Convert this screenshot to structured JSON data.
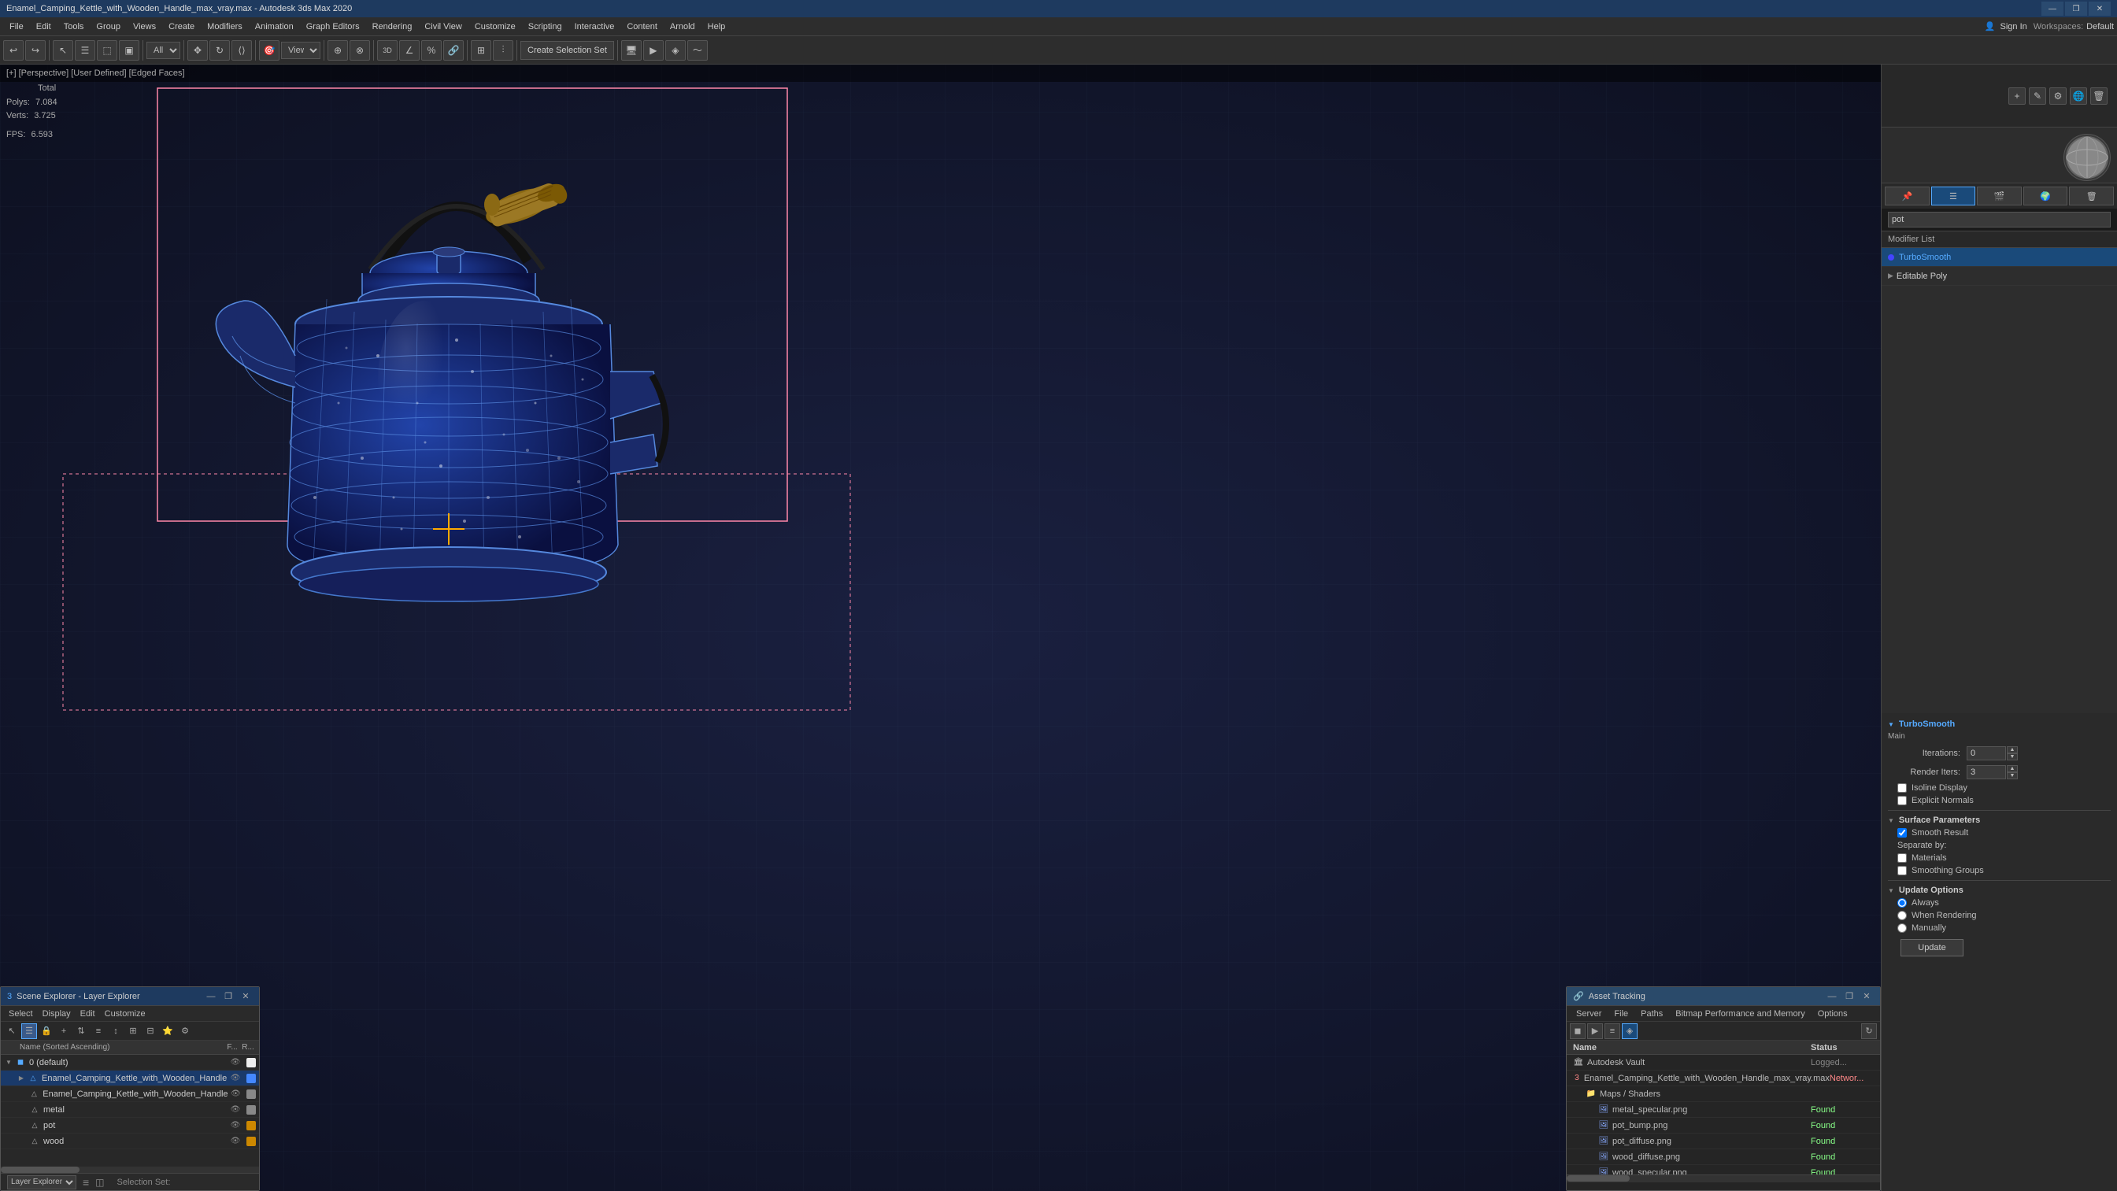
{
  "titlebar": {
    "title": "Enamel_Camping_Kettle_with_Wooden_Handle_max_vray.max - Autodesk 3ds Max 2020",
    "min": "—",
    "restore": "❐",
    "close": "✕"
  },
  "menubar": {
    "items": [
      "File",
      "Edit",
      "Tools",
      "Group",
      "Views",
      "Create",
      "Modifiers",
      "Animation",
      "Graph Editors",
      "Rendering",
      "Civil View",
      "Customize",
      "Scripting",
      "Interactive",
      "Content",
      "Arnold",
      "Help"
    ],
    "signin": "Sign In",
    "workspaces_label": "Workspaces:",
    "workspaces_value": "Default"
  },
  "toolbar": {
    "dropdown_all": "All",
    "view_label": "View",
    "create_selection": "Create Selection Set",
    "spinner_label": "3"
  },
  "viewport": {
    "header": "[+] [Perspective] [User Defined] [Edged Faces]",
    "stats": {
      "total_label": "Total",
      "polys_label": "Polys:",
      "polys_value": "7.084",
      "verts_label": "Verts:",
      "verts_value": "3.725",
      "fps_label": "FPS:",
      "fps_value": "6.593"
    }
  },
  "right_panel": {
    "search_placeholder": "pot",
    "modifier_list_label": "Modifier List",
    "modifiers": [
      {
        "name": "TurboSmooth",
        "selected": true
      },
      {
        "name": "Editable Poly",
        "selected": false
      }
    ],
    "turbosmooth": {
      "title": "TurboSmooth",
      "section_main": "Main",
      "iterations_label": "Iterations:",
      "iterations_value": "0",
      "render_iters_label": "Render Iters:",
      "render_iters_value": "3",
      "isoline_display": "Isoline Display",
      "explicit_normals": "Explicit Normals",
      "surface_params_label": "Surface Parameters",
      "smooth_result": "Smooth Result",
      "separate_by_label": "Separate by:",
      "materials_label": "Materials",
      "smoothing_groups_label": "Smoothing Groups",
      "update_options_label": "Update Options",
      "always_label": "Always",
      "when_rendering_label": "When Rendering",
      "manually_label": "Manually",
      "update_btn": "Update"
    }
  },
  "scene_explorer": {
    "title": "Scene Explorer - Layer Explorer",
    "menus": [
      "Select",
      "Display",
      "Edit",
      "Customize"
    ],
    "col_name": "Name (Sorted Ascending)",
    "col_f": "F...",
    "col_r": "R...",
    "items": [
      {
        "indent": 0,
        "name": "0 (default)",
        "has_expand": true,
        "type": "layer"
      },
      {
        "indent": 1,
        "name": "Enamel_Camping_Kettle_with_Wooden_Handle",
        "type": "object",
        "selected": true
      },
      {
        "indent": 2,
        "name": "Enamel_Camping_Kettle_with_Wooden_Handle",
        "type": "object"
      },
      {
        "indent": 2,
        "name": "metal",
        "type": "object"
      },
      {
        "indent": 2,
        "name": "pot",
        "type": "object"
      },
      {
        "indent": 2,
        "name": "wood",
        "type": "object"
      }
    ],
    "footer_label": "Layer Explorer",
    "selection_set_label": "Selection Set:"
  },
  "asset_tracking": {
    "title": "Asset Tracking",
    "menus": [
      "Server",
      "File",
      "Paths",
      "Bitmap Performance and Memory",
      "Options"
    ],
    "col_name": "Name",
    "col_status": "Status",
    "items": [
      {
        "indent": 0,
        "name": "Autodesk Vault",
        "status": "Logged...",
        "status_type": "logged",
        "type": "vault"
      },
      {
        "indent": 0,
        "name": "Enamel_Camping_Kettle_with_Wooden_Handle_max_vray.max",
        "status": "Networ...",
        "status_type": "network",
        "type": "file"
      },
      {
        "indent": 1,
        "name": "Maps / Shaders",
        "status": "",
        "type": "folder"
      },
      {
        "indent": 2,
        "name": "metal_specular.png",
        "status": "Found",
        "status_type": "found",
        "type": "image"
      },
      {
        "indent": 2,
        "name": "pot_bump.png",
        "status": "Found",
        "status_type": "found",
        "type": "image"
      },
      {
        "indent": 2,
        "name": "pot_diffuse.png",
        "status": "Found",
        "status_type": "found",
        "type": "image"
      },
      {
        "indent": 2,
        "name": "wood_diffuse.png",
        "status": "Found",
        "status_type": "found",
        "type": "image"
      },
      {
        "indent": 2,
        "name": "wood_specular.png",
        "status": "Found",
        "status_type": "found",
        "type": "image"
      }
    ]
  },
  "icons": {
    "expand": "▶",
    "collapse": "▼",
    "eye": "👁",
    "lock": "🔒",
    "file": "📄",
    "folder": "📁",
    "image": "🖼",
    "vault": "🏛"
  }
}
